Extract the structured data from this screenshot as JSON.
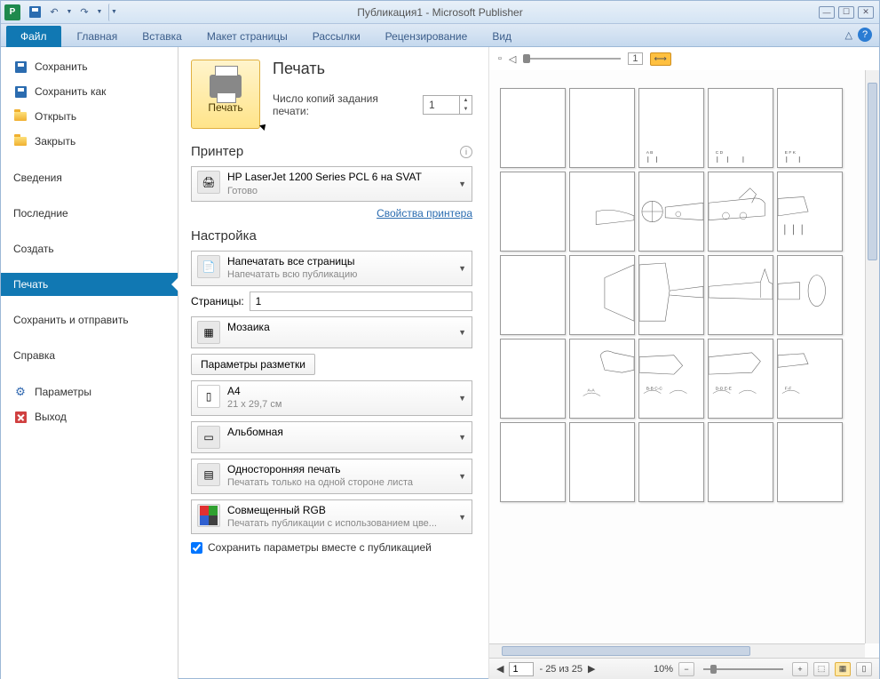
{
  "title": "Публикация1 - Microsoft Publisher",
  "app_abbrev": "P",
  "tabs": {
    "file": "Файл",
    "home": "Главная",
    "insert": "Вставка",
    "pagelayout": "Макет страницы",
    "mailings": "Рассылки",
    "review": "Рецензирование",
    "view": "Вид"
  },
  "sidebar": {
    "save": "Сохранить",
    "saveas": "Сохранить как",
    "open": "Открыть",
    "close": "Закрыть",
    "info": "Сведения",
    "recent": "Последние",
    "new": "Создать",
    "print": "Печать",
    "saveandsend": "Сохранить и отправить",
    "help": "Справка",
    "options": "Параметры",
    "exit": "Выход"
  },
  "print": {
    "heading": "Печать",
    "btn_label": "Печать",
    "copies_label": "Число копий задания печати:",
    "copies_value": "1",
    "printer_heading": "Принтер",
    "printer_name": "HP LaserJet 1200 Series PCL 6 на SVAT",
    "printer_status": "Готово",
    "printer_props": "Свойства принтера",
    "settings_heading": "Настройка",
    "allpages_title": "Напечатать все страницы",
    "allpages_sub": "Напечатать всю публикацию",
    "pages_label": "Страницы:",
    "pages_value": "1",
    "mosaic": "Мозаика",
    "layout_params": "Параметры разметки",
    "paper_title": "A4",
    "paper_sub": "21 x 29,7 см",
    "orientation": "Альбомная",
    "duplex_title": "Односторонняя печать",
    "duplex_sub": "Печатать только на одной стороне листа",
    "color_title": "Совмещенный RGB",
    "color_sub": "Печатать публикации с использованием цве...",
    "save_settings": "Сохранить параметры вместе с публикацией"
  },
  "status": {
    "page_value": "1",
    "page_range": "- 25 из 25",
    "zoom": "10%"
  },
  "toolbar": {
    "page_indicator": "1"
  }
}
